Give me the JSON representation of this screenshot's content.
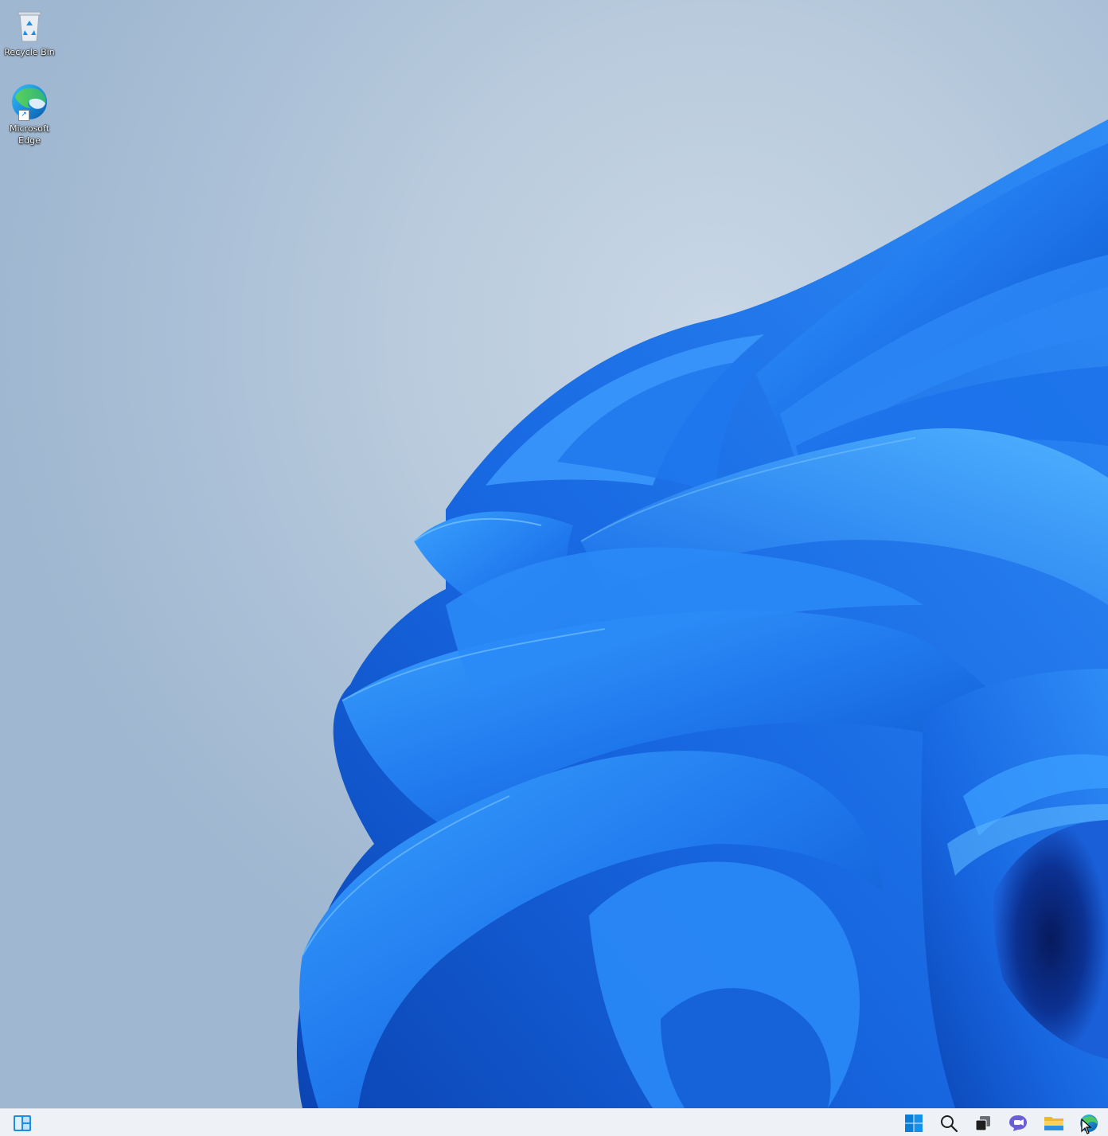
{
  "desktop": {
    "icons": [
      {
        "name": "recycle-bin",
        "label": "Recycle Bin",
        "icon": "recycle-bin-icon"
      },
      {
        "name": "microsoft-edge",
        "label": "Microsoft Edge",
        "icon": "edge-icon"
      }
    ],
    "wallpaper": "windows-11-bloom"
  },
  "taskbar": {
    "left": [
      {
        "name": "widgets-button",
        "icon": "widgets-icon"
      }
    ],
    "center": [
      {
        "name": "start-button",
        "icon": "windows-logo-icon"
      },
      {
        "name": "search-button",
        "icon": "search-icon"
      },
      {
        "name": "task-view-button",
        "icon": "task-view-icon"
      },
      {
        "name": "chat-button",
        "icon": "chat-icon"
      },
      {
        "name": "file-explorer-button",
        "icon": "folder-icon"
      },
      {
        "name": "edge-taskbar-button",
        "icon": "edge-icon"
      }
    ]
  },
  "colors": {
    "accent": "#0078d4",
    "taskbar_bg": "#eef1f5",
    "bloom_blue": "#1a6fe6"
  }
}
